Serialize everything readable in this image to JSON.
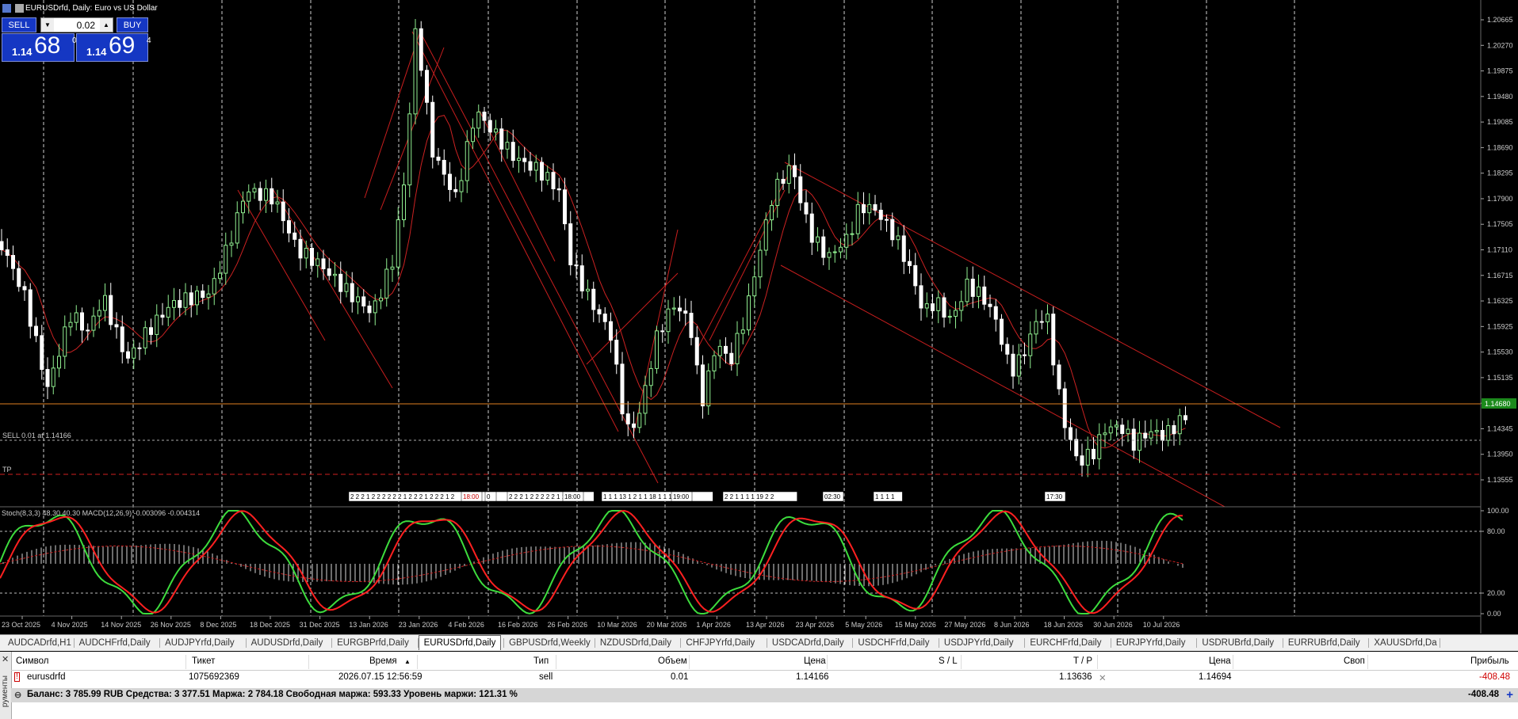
{
  "window": {
    "title": "EURUSDrfd, Daily:  Euro vs US Dollar"
  },
  "oneclick": {
    "sell_label": "SELL",
    "buy_label": "BUY",
    "lot_value": "0.02",
    "bid": {
      "prefix": "1.14",
      "big": "68",
      "sup": "0"
    },
    "ask": {
      "prefix": "1.14",
      "big": "69",
      "sup": "4"
    }
  },
  "chart": {
    "price_labels": [
      "1.20665",
      "1.20270",
      "1.19875",
      "1.19480",
      "1.19085",
      "1.18690",
      "1.18295",
      "1.17900",
      "1.17505",
      "1.17110",
      "1.16715",
      "1.16325",
      "1.15925",
      "1.15530",
      "1.15135",
      "1.14740",
      "1.14345",
      "1.13950",
      "1.13555"
    ],
    "current_price": "1.14680",
    "sell_line_label": "SELL 0.01 at 1.14166",
    "tp_label": "TP",
    "event_labels": [
      "2 2 2 1 2 2 2 2 2 2 1 2 2 2 1 2 2 2 1 2",
      "18:00",
      "0",
      "2 2 2 1 2 2 2 2 2 1 1",
      "18:00",
      "1 1 1 13 1 2 1 1 18 1 1 1 2",
      "19:00",
      "2 2 1 1 1 1 19 2 2",
      "02:30",
      "1 1 1 1",
      "17:30"
    ],
    "date_labels": [
      "23 Oct 2025",
      "4 Nov 2025",
      "14 Nov 2025",
      "26 Nov 2025",
      "8 Dec 2025",
      "18 Dec 2025",
      "31 Dec 2025",
      "13 Jan 2026",
      "23 Jan 2026",
      "4 Feb 2026",
      "16 Feb 2026",
      "26 Feb 2026",
      "10 Mar 2026",
      "20 Mar 2026",
      "1 Apr 2026",
      "13 Apr 2026",
      "23 Apr 2026",
      "5 May 2026",
      "15 May 2026",
      "27 May 2026",
      "8 Jun 2026",
      "18 Jun 2026",
      "30 Jun 2026",
      "10 Jul 2026"
    ]
  },
  "indicator": {
    "label": "Stoch(8,3,3) 48.30 40.30 MACD(12,26,9) -0.003096 -0.004314",
    "levels": [
      "100.00",
      "80.00",
      "20.00",
      "0.00"
    ]
  },
  "tabs": [
    "AUDCADrfd,H1",
    "AUDCHFrfd,Daily",
    "AUDJPYrfd,Daily",
    "AUDUSDrfd,Daily",
    "EURGBPrfd,Daily",
    "EURUSDrfd,Daily",
    "GBPUSDrfd,Weekly",
    "NZDUSDrfd,Daily",
    "CHFJPYrfd,Daily",
    "USDCADrfd,Daily",
    "USDCHFrfd,Daily",
    "USDJPYrfd,Daily",
    "EURCHFrfd,Daily",
    "EURJPYrfd,Daily",
    "USDRUBrfd,Daily",
    "EURRUBrfd,Daily",
    "XAUUSDrfd,Da"
  ],
  "active_tab": "EURUSDrfd,Daily",
  "terminal": {
    "side_label": "рументы",
    "headers": {
      "symbol": "Символ",
      "ticket": "Тикет",
      "time": "Время",
      "type": "Тип",
      "volume": "Объем",
      "price": "Цена",
      "sl": "S / L",
      "tp": "T / P",
      "cur_price": "Цена",
      "swap": "Своп",
      "profit": "Прибыль"
    },
    "row": {
      "symbol": "eurusdrfd",
      "ticket": "1075692369",
      "time": "2026.07.15 12:56:59",
      "type": "sell",
      "volume": "0.01",
      "price": "1.14166",
      "sl": "",
      "tp": "1.13636",
      "cur_price": "1.14694",
      "swap": "",
      "profit": "-408.48"
    },
    "summary": "Баланс: 3 785.99 RUB  Средства: 3 377.51  Маржа: 2 784.18  Свободная маржа: 593.33  Уровень маржи: 121.31 %",
    "summary_total": "-408.48"
  },
  "colors": {
    "bull": "#90ee90",
    "bear": "#ffffff",
    "ma": "#cc2222",
    "stoch_main": "#3ddc3d",
    "stoch_signal": "#ff2020",
    "accent": "#1537c3",
    "loss": "#d00000"
  }
}
